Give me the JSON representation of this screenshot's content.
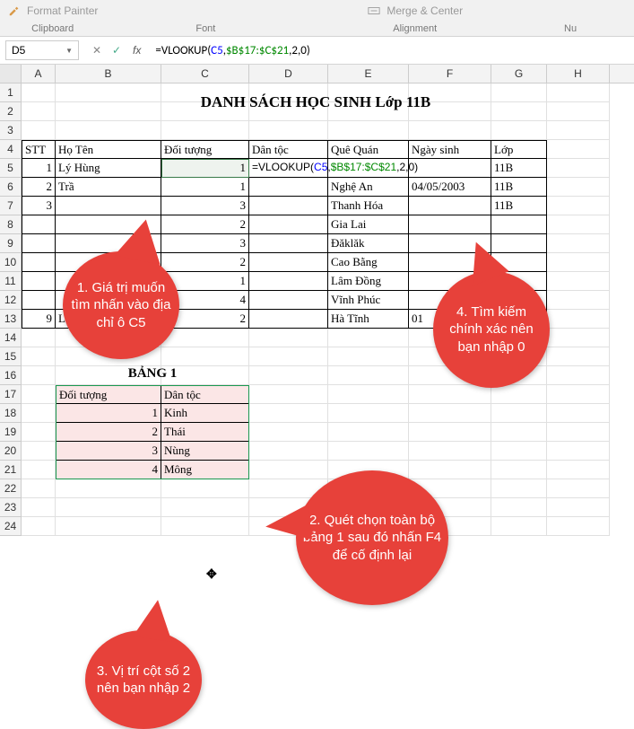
{
  "ribbon": {
    "format_painter": "Format Painter",
    "group_clipboard": "Clipboard",
    "group_font": "Font",
    "group_alignment": "Alignment",
    "merge_center": "Merge & Center",
    "group_nu": "Nu"
  },
  "namebox": "D5",
  "formula_bar": {
    "prefix": "=VLOOKUP(",
    "a1": "C5",
    "c1": ",",
    "a2": "$B$17:$C$21",
    "suffix": ",2,0)"
  },
  "columns": [
    "A",
    "B",
    "C",
    "D",
    "E",
    "F",
    "G",
    "H"
  ],
  "row_numbers": [
    "1",
    "2",
    "3",
    "4",
    "5",
    "6",
    "7",
    "8",
    "9",
    "10",
    "11",
    "12",
    "13",
    "14",
    "15",
    "16",
    "17",
    "18",
    "19",
    "20",
    "21",
    "22",
    "23",
    "24"
  ],
  "title": "DANH SÁCH HỌC SINH Lớp 11B",
  "headers": {
    "stt": "STT",
    "hoten": "Họ Tên",
    "doituong": "Đối tượng",
    "dantoc": "Dân tộc",
    "quequan": "Quê Quán",
    "ngaysinh": "Ngày sinh",
    "lop": "Lớp"
  },
  "rows": [
    {
      "stt": "1",
      "hoten": "Lý Hùng",
      "dt": "1",
      "dantoc_formula": {
        "pre": "=VLOOKUP(",
        "a1": "C5",
        "c1": ",",
        "a2": "$B$17:$C$21",
        "suf": ",2,0)"
      },
      "que": "",
      "ns": "",
      "lop": "11B"
    },
    {
      "stt": "2",
      "hoten": "Trầ",
      "dt": "1",
      "que": "Nghệ An",
      "ns": "04/05/2003",
      "lop": "11B"
    },
    {
      "stt": "3",
      "hoten": "",
      "dt": "3",
      "que": "Thanh Hóa",
      "ns": "",
      "lop": "11B"
    },
    {
      "stt": "",
      "hoten": "",
      "dt": "2",
      "que": "Gia Lai",
      "ns": "",
      "lop": ""
    },
    {
      "stt": "",
      "hoten": "",
      "dt": "3",
      "que": "Đăklăk",
      "ns": "",
      "lop": ""
    },
    {
      "stt": "",
      "hoten": "",
      "dt": "2",
      "que": "Cao Bằng",
      "ns": "",
      "lop": ""
    },
    {
      "stt": "",
      "hoten": "",
      "dt": "1",
      "que": "Lâm Đồng",
      "ns": "",
      "lop": ""
    },
    {
      "stt": "",
      "hoten": "",
      "dt": "4",
      "que": "Vĩnh Phúc",
      "ns": "",
      "lop": ""
    },
    {
      "stt": "9",
      "hoten": "L",
      "dt": "2",
      "que": "Hà Tĩnh",
      "ns": "01",
      "lop": ""
    }
  ],
  "bang1": {
    "title": "BẢNG 1",
    "h1": "Đối tượng",
    "h2": "Dân tộc",
    "rows": [
      {
        "k": "1",
        "v": "Kinh"
      },
      {
        "k": "2",
        "v": "Thái"
      },
      {
        "k": "3",
        "v": "Nùng"
      },
      {
        "k": "4",
        "v": "Mông"
      }
    ]
  },
  "callouts": {
    "c1": "1. Giá trị muốn tìm nhấn vào địa chỉ ô C5",
    "c2": "2. Quét chọn toàn bộ bảng 1 sau đó nhấn F4 để cố định lại",
    "c3": "3. Vị trí cột số 2 nên bạn nhập 2",
    "c4": "4. Tìm kiếm chính xác nên bạn nhập 0"
  }
}
